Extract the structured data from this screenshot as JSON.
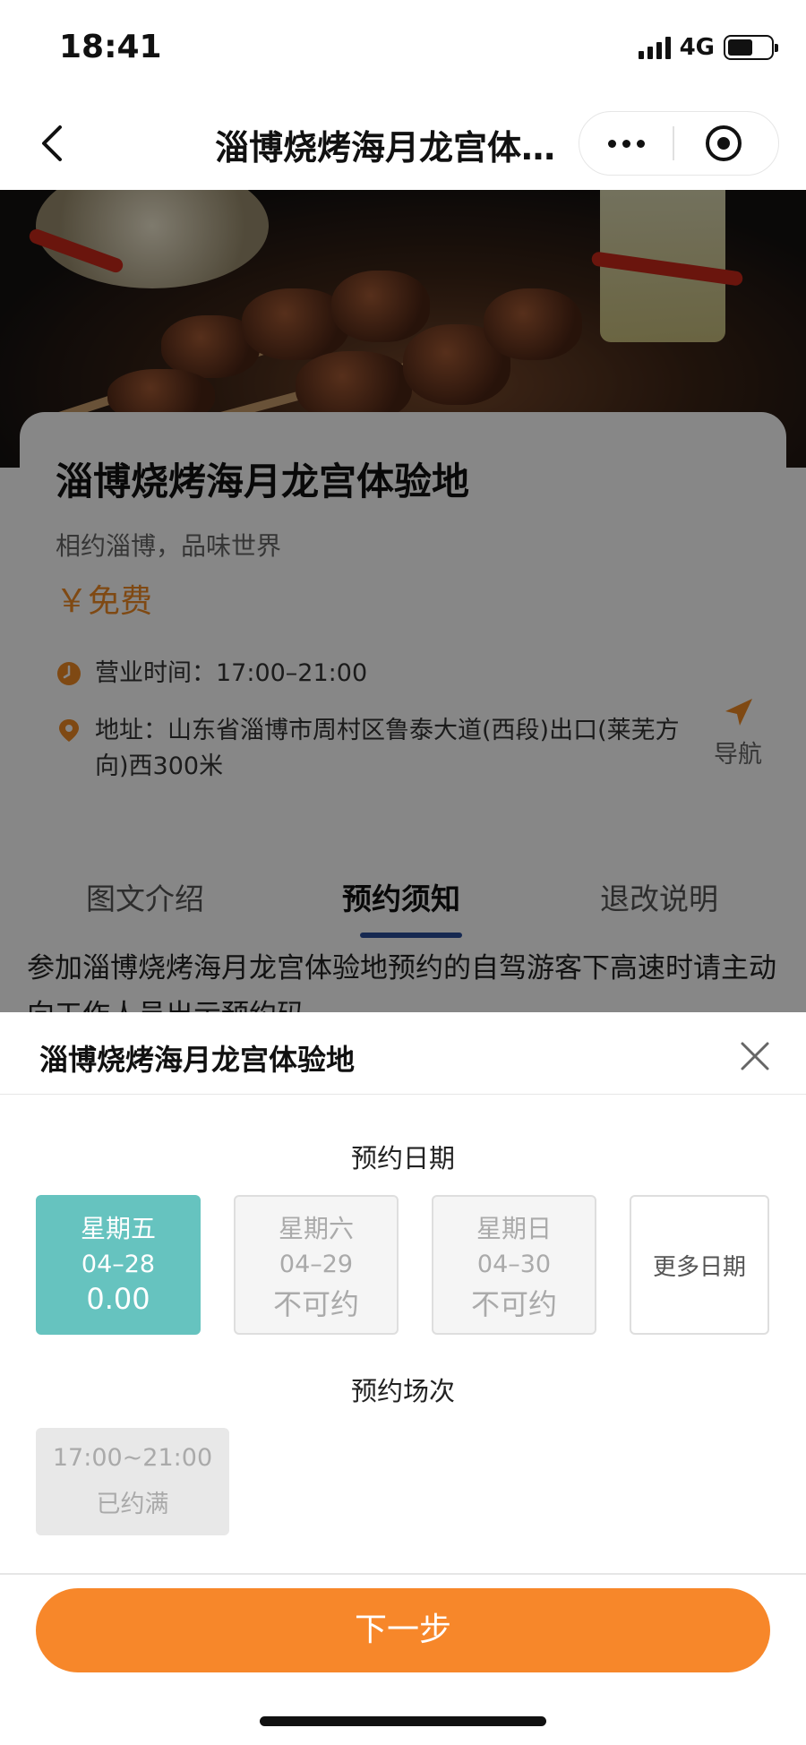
{
  "status_bar": {
    "time": "18:41",
    "network": "4G"
  },
  "nav": {
    "title": "淄博烧烤海月龙宫体…"
  },
  "venue": {
    "name": "淄博烧烤海月龙宫体验地",
    "slogan": "相约淄博，品味世界",
    "price": "￥免费",
    "hours": "营业时间：17:00–21:00",
    "address": "地址：山东省淄博市周村区鲁泰大道(西段)出口(莱芜方向)西300米",
    "nav_label": "导航"
  },
  "tabs": [
    {
      "label": "图文介绍"
    },
    {
      "label": "预约须知"
    },
    {
      "label": "退改说明"
    }
  ],
  "notice_text": "参加淄博烧烤海月龙宫体验地预约的自驾游客下高速时请主动向工作人员出示预约码",
  "sheet": {
    "title": "淄博烧烤海月龙宫体验地",
    "date_label": "预约日期",
    "dates": [
      {
        "weekday": "星期五",
        "date": "04–28",
        "status": "0.00"
      },
      {
        "weekday": "星期六",
        "date": "04–29",
        "status": "不可约"
      },
      {
        "weekday": "星期日",
        "date": "04–30",
        "status": "不可约"
      }
    ],
    "more_dates": "更多日期",
    "slot_label": "预约场次",
    "slot": {
      "time": "17:00~21:00",
      "status": "已约满"
    },
    "next_button": "下一步"
  },
  "colors": {
    "accent_orange": "#f7872a",
    "price_orange": "#f08a24",
    "selected_teal": "#66c3bf",
    "tab_underline": "#2a4f9a"
  },
  "icons": {
    "back": "chevron-left-icon",
    "more": "more-dots-icon",
    "close_mini_program": "target-ring-icon",
    "hours": "clock-icon",
    "address": "location-pin-icon",
    "navigate": "navigation-arrow-icon",
    "sheet_close": "close-icon"
  }
}
